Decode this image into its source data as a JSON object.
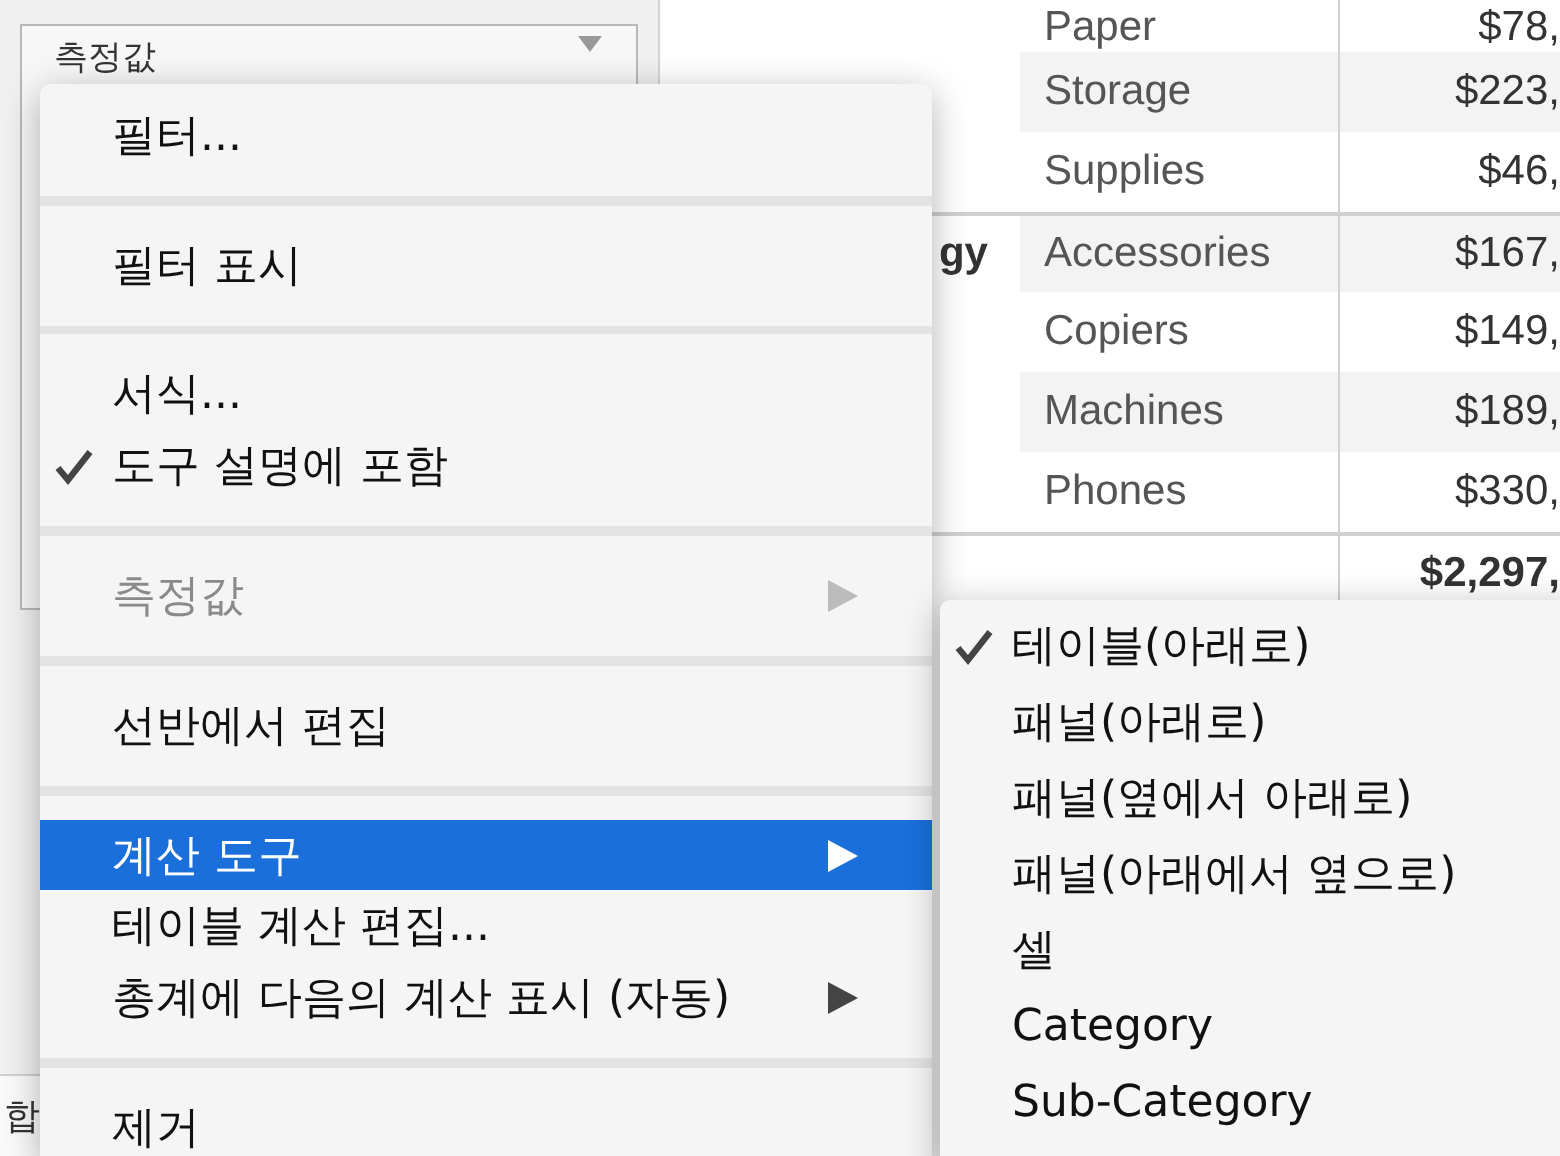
{
  "shelf": {
    "title": "측정값"
  },
  "table": {
    "rows": [
      {
        "category": "",
        "sub_category": "Paper",
        "value": "$78,",
        "shaded": false,
        "group_start": false
      },
      {
        "category": "",
        "sub_category": "Storage",
        "value": "$223,",
        "shaded": true,
        "group_start": false
      },
      {
        "category": "",
        "sub_category": "Supplies",
        "value": "$46,",
        "shaded": false,
        "group_start": false
      },
      {
        "category": "gy",
        "sub_category": "Accessories",
        "value": "$167,",
        "shaded": true,
        "group_start": true
      },
      {
        "category": "",
        "sub_category": "Copiers",
        "value": "$149,",
        "shaded": false,
        "group_start": false
      },
      {
        "category": "",
        "sub_category": "Machines",
        "value": "$189,",
        "shaded": true,
        "group_start": false
      },
      {
        "category": "",
        "sub_category": "Phones",
        "value": "$330,",
        "shaded": false,
        "group_start": false
      }
    ],
    "total": "$2,297,"
  },
  "status_bar": {
    "text": "합"
  },
  "context_menu": {
    "items": [
      {
        "kind": "item",
        "label": "필터...",
        "checked": false,
        "disabled": false,
        "selected": false,
        "submenu": false
      },
      {
        "kind": "separator"
      },
      {
        "kind": "item",
        "label": "필터 표시",
        "checked": false,
        "disabled": false,
        "selected": false,
        "submenu": false
      },
      {
        "kind": "separator"
      },
      {
        "kind": "item",
        "label": "서식...",
        "checked": false,
        "disabled": false,
        "selected": false,
        "submenu": false
      },
      {
        "kind": "item",
        "label": "도구 설명에 포함",
        "checked": true,
        "disabled": false,
        "selected": false,
        "submenu": false
      },
      {
        "kind": "separator"
      },
      {
        "kind": "item",
        "label": "측정값",
        "checked": false,
        "disabled": true,
        "selected": false,
        "submenu": true
      },
      {
        "kind": "separator"
      },
      {
        "kind": "item",
        "label": "선반에서 편집",
        "checked": false,
        "disabled": false,
        "selected": false,
        "submenu": false
      },
      {
        "kind": "separator"
      },
      {
        "kind": "item",
        "label": "계산 도구",
        "checked": false,
        "disabled": false,
        "selected": true,
        "submenu": true
      },
      {
        "kind": "item",
        "label": "테이블 계산 편집...",
        "checked": false,
        "disabled": false,
        "selected": false,
        "submenu": false
      },
      {
        "kind": "item",
        "label": "총계에 다음의 계산 표시 (자동)",
        "checked": false,
        "disabled": false,
        "selected": false,
        "submenu": true
      },
      {
        "kind": "separator"
      },
      {
        "kind": "item",
        "label": "제거",
        "checked": false,
        "disabled": false,
        "selected": false,
        "submenu": false
      }
    ]
  },
  "submenu": {
    "items": [
      {
        "label": "테이블(아래로)",
        "checked": true
      },
      {
        "label": "패널(아래로)",
        "checked": false
      },
      {
        "label": "패널(옆에서 아래로)",
        "checked": false
      },
      {
        "label": "패널(아래에서 옆으로)",
        "checked": false
      },
      {
        "label": "셀",
        "checked": false
      },
      {
        "label": "Category",
        "checked": false
      },
      {
        "label": "Sub-Category",
        "checked": false
      }
    ]
  }
}
